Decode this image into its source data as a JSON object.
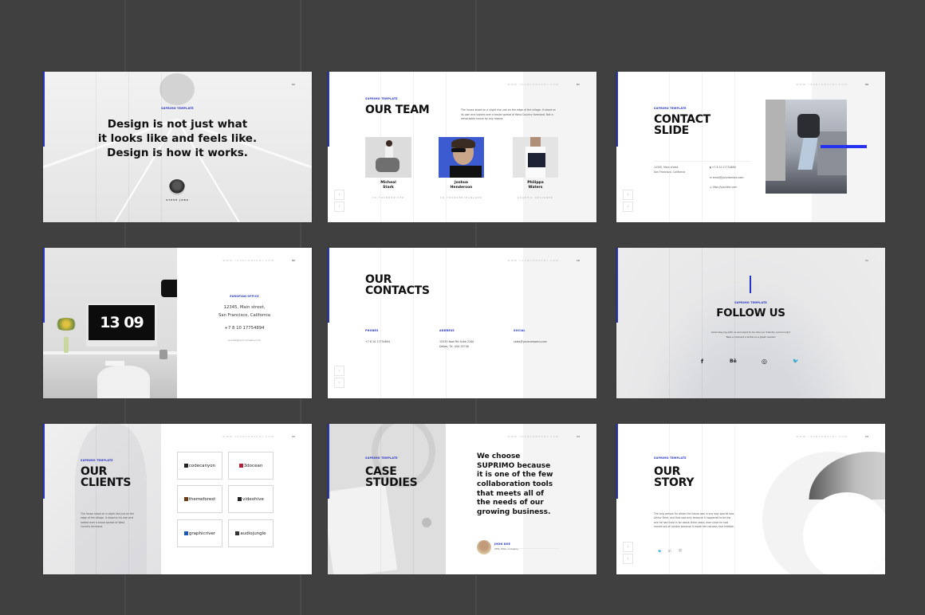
{
  "background_color": "#404040",
  "accent_color": "#2533c9",
  "common": {
    "kicker": "SUPRIMO TEMPLATE",
    "url": "WWW.YOURCOMPANY.COM",
    "nav_next": "›",
    "nav_prev": "‹"
  },
  "slides": [
    {
      "id": "quote",
      "page": "02",
      "quote_lines": [
        "Design is not just what",
        "it looks like and feels like.",
        "Design is how it works."
      ],
      "author": "STEVE JOBS"
    },
    {
      "id": "team",
      "page": "07",
      "title": "OUR TEAM",
      "body": "The house stood on a slight rise just on the edge of the village. It stood on its own and looked over a broad spread of West Country farmland. Not a remarkable house by any means.",
      "members": [
        {
          "first": "Micheal",
          "last": "Stark",
          "role": "CO-FOUNDER/CEO"
        },
        {
          "first": "Joshua",
          "last": "Henderson",
          "role": "CO-FOUNDER/MANAGER"
        },
        {
          "first": "Philippa",
          "last": "Waters",
          "role": "GRAPHIC DESIGNER"
        }
      ]
    },
    {
      "id": "contact",
      "page": "08",
      "title_lines": [
        "CONTACT",
        "SLIDE"
      ],
      "address_lines": [
        "12345, Main street,",
        "San Francisco, California"
      ],
      "phone": "+7 8 10 17754894",
      "email": "email@yourdomain.com",
      "website": "http://yoursite.com"
    },
    {
      "id": "office",
      "page": "09",
      "clock": "13 09",
      "label": "EUROPIAN OFFICE",
      "address_lines": [
        "12345, Main street,",
        "San Francisco, California"
      ],
      "phone": "+7 8 10 17754894",
      "email": "europe@yourcompany.com"
    },
    {
      "id": "contacts",
      "page": "10",
      "title_lines": [
        "OUR",
        "CONTACTS"
      ],
      "columns": [
        {
          "label": "PHONES",
          "lines": [
            "+7 8 10 17754894"
          ]
        },
        {
          "label": "ADDRESS",
          "lines": [
            "15533 Noel Rd Suite 2200",
            "Dallas, TX, USA 25740"
          ]
        },
        {
          "label": "SOCIAL",
          "lines": [
            "sales@yourcompany.com"
          ]
        }
      ]
    },
    {
      "id": "follow",
      "page": "11",
      "title": "FOLLOW US",
      "body_lines": [
        "Liked staying with us and want to be into our friendly community?",
        "Take a moment a write us a great review!"
      ],
      "icons": [
        "facebook-icon",
        "behance-icon",
        "dribbble-icon",
        "twitter-icon"
      ],
      "icon_glyphs": [
        "f",
        "Bē",
        "◎",
        "🐦"
      ]
    },
    {
      "id": "clients",
      "page": "12",
      "title_lines": [
        "OUR",
        "CLIENTS"
      ],
      "body": "The house stood on a slight rise just on the edge of the village. It stood on its own and looked over a broad spread of West Country farmland.",
      "logos": [
        {
          "name": "codecanyon",
          "color": "#222222"
        },
        {
          "name": "3docean",
          "color": "#b0203a"
        },
        {
          "name": "themeforest",
          "color": "#6b3b12"
        },
        {
          "name": "videohive",
          "color": "#222222"
        },
        {
          "name": "graphicriver",
          "color": "#1e58b8"
        },
        {
          "name": "audiojungle",
          "color": "#333333"
        }
      ]
    },
    {
      "id": "case",
      "page": "13",
      "title_lines": [
        "CASE",
        "STUDIES"
      ],
      "quote_lines": [
        "We choose",
        "SUPRIMO because",
        "it is one of the few",
        "collaboration tools",
        "that meets all of",
        "the needs of our",
        "growing business."
      ],
      "author": "JHON DOE",
      "author_role": "CEO, Main company"
    },
    {
      "id": "story",
      "page": "14",
      "title_lines": [
        "OUR",
        "STORY"
      ],
      "body": "The only person for whom the house was in any way special was Arthur Dent, and that was only because it happened to be the one he had lived in for about three years, ever since he had moved out of London because it made him nervous and irritable.",
      "icons": [
        "twitter-icon",
        "linkedin-icon",
        "dribbble-icon"
      ],
      "icon_glyphs": [
        "🐦",
        "in",
        "◎"
      ]
    }
  ]
}
